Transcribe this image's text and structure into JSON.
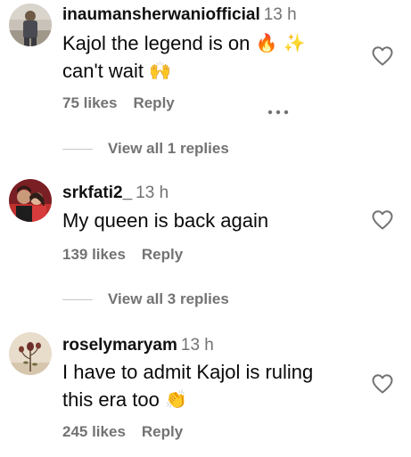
{
  "comments": [
    {
      "username": "inaumansherwaniofficial",
      "time": "13 h",
      "text_line1": "Kajol the legend is on",
      "text_line2": "can't wait",
      "emoji_1": "🔥",
      "emoji_2": "✨",
      "emoji_3": "🙌",
      "likes": "75 likes",
      "reply": "Reply",
      "view_replies": "View all 1 replies",
      "icons": {
        "more": "more-dots-icon",
        "like": "heart-icon"
      }
    },
    {
      "username": "srkfati2_",
      "time": "13 h",
      "text_line1": "My queen is back again",
      "likes": "139 likes",
      "reply": "Reply",
      "view_replies": "View all 3 replies",
      "icons": {
        "like": "heart-icon"
      }
    },
    {
      "username": "roselymaryam",
      "time": "13 h",
      "text_line1": "I have to admit Kajol is ruling",
      "text_line2": "this era too",
      "emoji_1": "👏",
      "likes": "245 likes",
      "reply": "Reply",
      "icons": {
        "like": "heart-icon"
      }
    }
  ],
  "colors": {
    "text": "#0a0a0a",
    "secondary": "#737373",
    "divider": "#c7c7c7",
    "fire": "#ff5a1f",
    "sparkle": "#f7c13a",
    "hands": "#f5c04a"
  }
}
